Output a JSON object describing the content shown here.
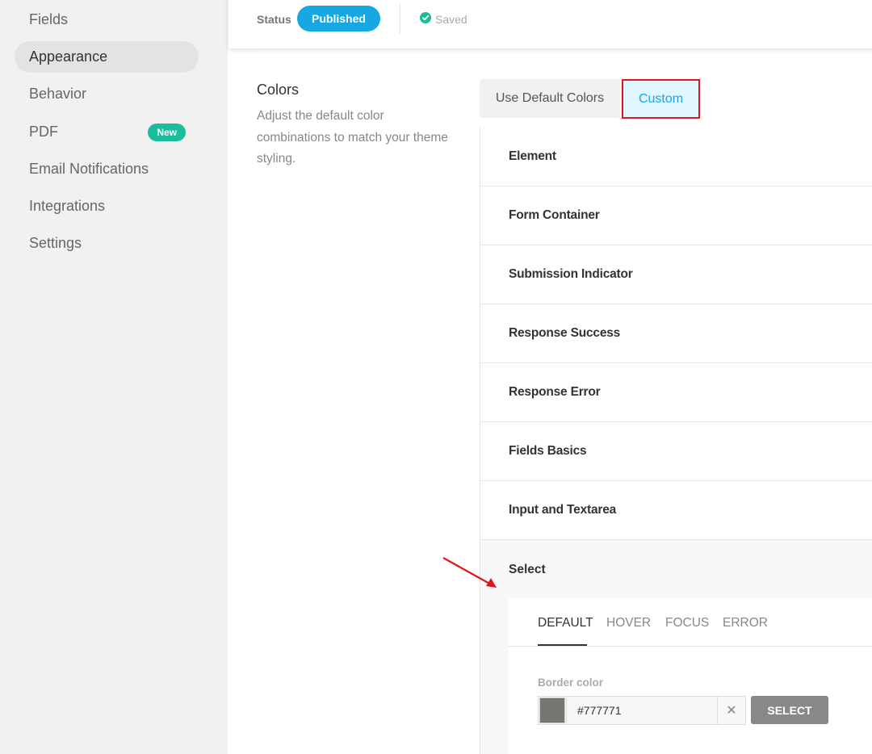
{
  "sidebar": {
    "items": [
      {
        "label": "Fields"
      },
      {
        "label": "Appearance"
      },
      {
        "label": "Behavior"
      },
      {
        "label": "PDF",
        "badge": "New"
      },
      {
        "label": "Email Notifications"
      },
      {
        "label": "Integrations"
      },
      {
        "label": "Settings"
      }
    ]
  },
  "header": {
    "status_label": "Status",
    "status_value": "Published",
    "saved_text": "Saved"
  },
  "colors": {
    "title": "Colors",
    "description": "Adjust the default color combinations to match your theme styling.",
    "tabs": [
      {
        "label": "Use Default Colors"
      },
      {
        "label": "Custom"
      }
    ]
  },
  "accordion": {
    "items": [
      {
        "label": "Element"
      },
      {
        "label": "Form Container"
      },
      {
        "label": "Submission Indicator"
      },
      {
        "label": "Response Success"
      },
      {
        "label": "Response Error"
      },
      {
        "label": "Fields Basics"
      },
      {
        "label": "Input and Textarea"
      },
      {
        "label": "Select"
      }
    ]
  },
  "select_panel": {
    "state_tabs": [
      {
        "label": "DEFAULT"
      },
      {
        "label": "HOVER"
      },
      {
        "label": "FOCUS"
      },
      {
        "label": "ERROR"
      }
    ],
    "border_color_label": "Border color",
    "border_color_value": "#777771",
    "clear_symbol": "✕",
    "select_button": "SELECT"
  },
  "colors_meta": {
    "accent": "#17a8e3",
    "badge": "#1abc9c",
    "highlight_border": "#e0161c",
    "swatch": "#777771"
  }
}
